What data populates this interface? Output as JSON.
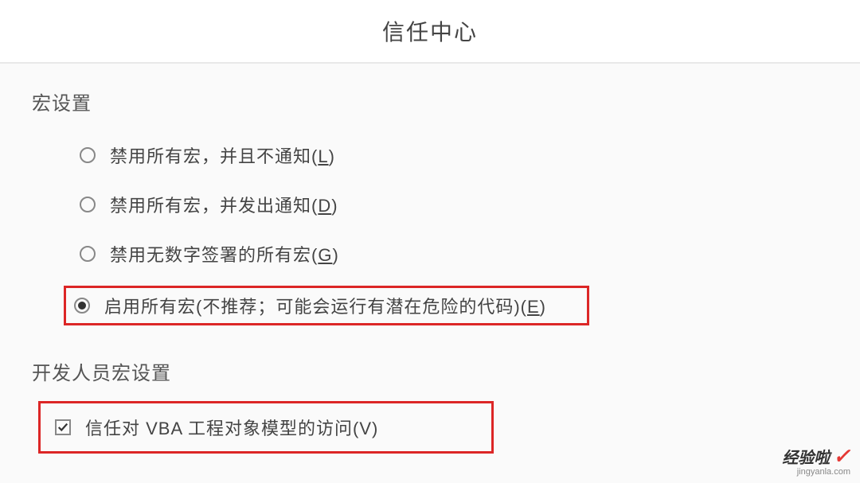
{
  "dialog": {
    "title": "信任中心"
  },
  "sections": {
    "macro_settings": {
      "title": "宏设置",
      "options": [
        {
          "label": "禁用所有宏，并且不通知(",
          "hotkey": "L",
          "suffix": ")",
          "selected": false
        },
        {
          "label": "禁用所有宏，并发出通知(",
          "hotkey": "D",
          "suffix": ")",
          "selected": false
        },
        {
          "label": "禁用无数字签署的所有宏(",
          "hotkey": "G",
          "suffix": ")",
          "selected": false
        },
        {
          "label": "启用所有宏(不推荐；可能会运行有潜在危险的代码)(",
          "hotkey": "E",
          "suffix": ")",
          "selected": true
        }
      ]
    },
    "developer_settings": {
      "title": "开发人员宏设置",
      "options": [
        {
          "label": "信任对 VBA 工程对象模型的访问(",
          "hotkey": "V",
          "suffix": ")",
          "checked": true
        }
      ]
    }
  },
  "watermark": {
    "main": "经验啦",
    "check": "✓",
    "sub": "jingyanla.com"
  }
}
